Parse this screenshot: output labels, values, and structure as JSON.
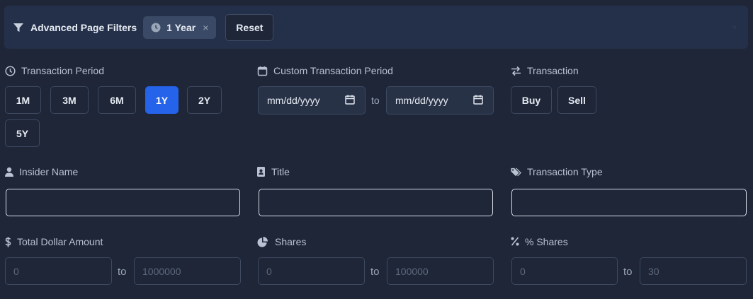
{
  "header": {
    "title": "Advanced Page Filters",
    "chip_label": "1 Year",
    "chip_close": "×",
    "reset_label": "Reset"
  },
  "transaction_period": {
    "label": "Transaction Period",
    "buttons": [
      "1M",
      "3M",
      "6M",
      "1Y",
      "2Y",
      "5Y"
    ],
    "active": "1Y"
  },
  "custom_period": {
    "label": "Custom Transaction Period",
    "from_placeholder": "mm/dd/yyyy",
    "to_label": "to",
    "to_placeholder": "mm/dd/yyyy"
  },
  "transaction": {
    "label": "Transaction",
    "buttons": [
      "Buy",
      "Sell"
    ]
  },
  "insider_name": {
    "label": "Insider Name",
    "value": ""
  },
  "title_field": {
    "label": "Title",
    "value": ""
  },
  "transaction_type": {
    "label": "Transaction Type",
    "value": ""
  },
  "total_dollar_amount": {
    "label": "Total Dollar Amount",
    "min_placeholder": "0",
    "to_label": "to",
    "max_placeholder": "1000000"
  },
  "shares": {
    "label": "Shares",
    "min_placeholder": "0",
    "to_label": "to",
    "max_placeholder": "100000"
  },
  "percent_shares": {
    "label": "% Shares",
    "min_placeholder": "0",
    "to_label": "to",
    "max_placeholder": "30"
  },
  "colors": {
    "background": "#1e2638",
    "header_bg": "#243049",
    "accent": "#2563eb",
    "chip_bg": "#3a4a66"
  },
  "icons": [
    "filter-icon",
    "clock-icon",
    "calendar-icon",
    "exchange-icon",
    "user-icon",
    "id-badge-icon",
    "tags-icon",
    "dollar-icon",
    "pie-chart-icon",
    "percent-icon"
  ]
}
